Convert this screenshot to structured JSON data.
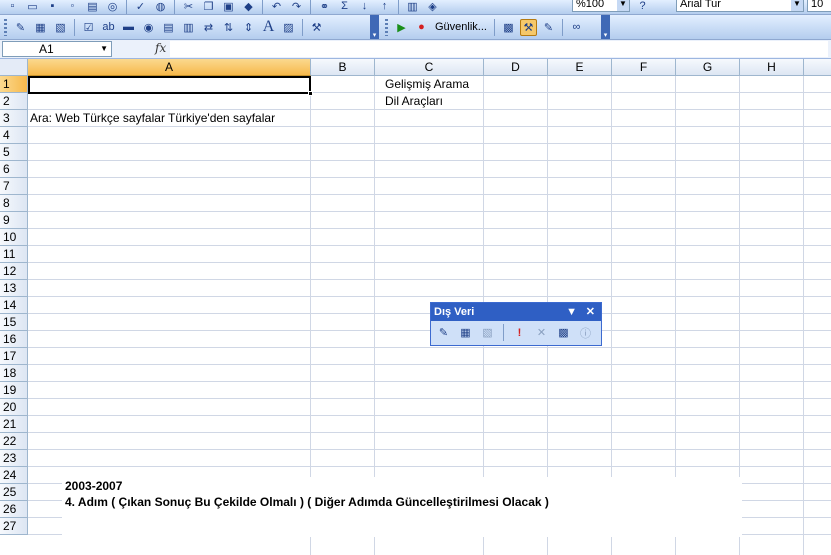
{
  "toolbar": {
    "zoom_value": "%100",
    "font_name": "Arial Tur",
    "font_size": "10",
    "security_label": "Güvenlik..."
  },
  "formula_bar": {
    "name_box": "A1",
    "fx_label": "fx",
    "formula": ""
  },
  "grid": {
    "columns": [
      "A",
      "B",
      "C",
      "D",
      "E",
      "F",
      "G",
      "H"
    ],
    "rows": [
      "1",
      "2",
      "3",
      "4",
      "5",
      "6",
      "7",
      "8",
      "9",
      "10",
      "11",
      "12",
      "13",
      "14",
      "15",
      "16",
      "17",
      "18",
      "19",
      "20",
      "21",
      "22",
      "23",
      "24",
      "25",
      "26",
      "27"
    ],
    "cells": {
      "C1": "Gelişmiş Arama",
      "C2": "Dil Araçları",
      "A3": "Ara: Web Türkçe sayfalar Türkiye'den sayfalar"
    }
  },
  "text_object": {
    "line1": "2003-2007",
    "line2": "4. Adım ( Çıkan Sonuç Bu Çekilde Olmalı ) ( Diğer Adımda Güncelleştirilmesi Olacak )"
  },
  "floating_toolbar": {
    "title": "Dış Veri",
    "icons": [
      "refresh-data-icon",
      "data-range-properties-icon",
      "query-parameters-icon",
      "refresh-all-icon",
      "cancel-refresh-icon",
      "refresh-status-icon",
      "info-icon"
    ]
  },
  "colors": {
    "toolbar_bg": "#c3daf7",
    "selected_header": "#f7b94c",
    "floating_title": "#2f5fc4"
  }
}
